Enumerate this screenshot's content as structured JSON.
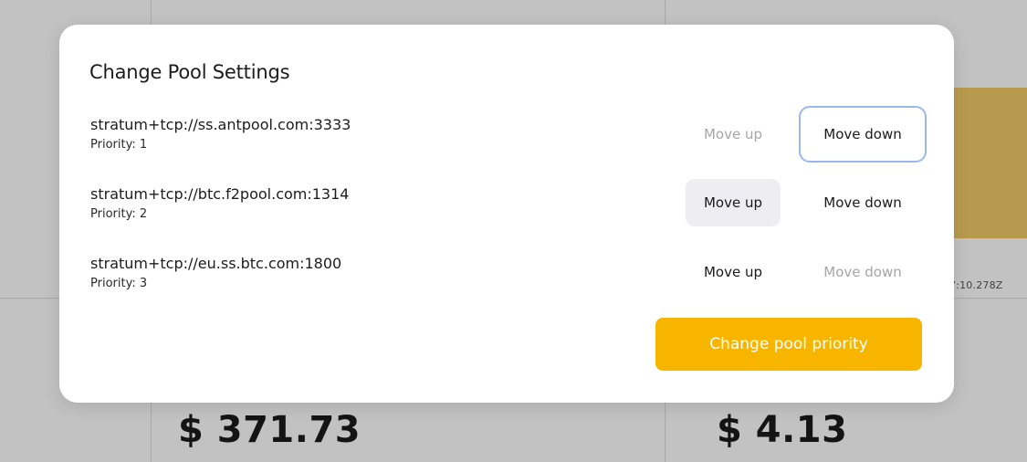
{
  "background": {
    "timestamp_fragment": "7:10.278Z",
    "stat_left": "$ 371.73",
    "stat_right": "$ 4.13"
  },
  "modal": {
    "title": "Change Pool Settings",
    "pools": [
      {
        "url": "stratum+tcp://ss.antpool.com:3333",
        "priority": "Priority: 1",
        "move_up": "Move up",
        "move_down": "Move down",
        "move_up_enabled": false,
        "move_down_enabled": true
      },
      {
        "url": "stratum+tcp://btc.f2pool.com:1314",
        "priority": "Priority: 2",
        "move_up": "Move up",
        "move_down": "Move down",
        "move_up_enabled": true,
        "move_down_enabled": true
      },
      {
        "url": "stratum+tcp://eu.ss.btc.com:1800",
        "priority": "Priority: 3",
        "move_up": "Move up",
        "move_down": "Move down",
        "move_up_enabled": true,
        "move_down_enabled": false
      }
    ],
    "submit_label": "Change pool priority"
  },
  "colors": {
    "accent": "#f7b500",
    "focus_ring": "#9bb8ec",
    "disabled_text": "#a6a6a6",
    "background_bar": "#b89a4e"
  }
}
